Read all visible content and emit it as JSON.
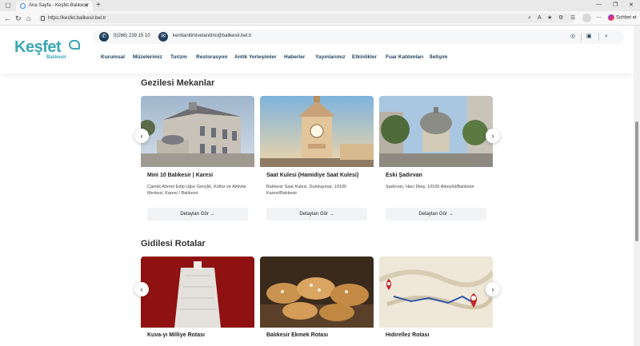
{
  "browser": {
    "tab_title": "Ana Sayfa - Keşfet Balıkesir",
    "url": "https://kesfet.balikesir.bel.tr",
    "copilot_label": "Sohbet et"
  },
  "header": {
    "logo_word": "Keşfet",
    "logo_sub": "Balıkesir",
    "phone": "0(266) 239 15 10",
    "email": "kenttanitimivetanitimi@balikesir.bel.tr",
    "menu": [
      "Kurumsal",
      "Müzelerimiz",
      "Turizm",
      "Restorasyon",
      "Antik Yerleşimler",
      "Haberler",
      "Yayınlarımız",
      "Etkinlikler",
      "Fuar Katılımları",
      "İletişim"
    ]
  },
  "places": {
    "title": "Gezilesi Mekanlar",
    "items": [
      {
        "name": "Mini 10 Balıkesir | Karesi",
        "address": "Çamlık Ahmet Edip Uğur Gençlik, Kültür ve Aktivite Merkezi, Karesi / Balıkesir",
        "button": "Detayları Gör"
      },
      {
        "name": "Saat Kulesi (Hamidiye Saat Kulesi)",
        "address": "Balıkesir Saat Kulesi, Dumlupınar, 10100 Karesi/Balıkesir",
        "button": "Detayları Gör"
      },
      {
        "name": "Eski Şadırvan",
        "address": "Şadırvan, Hacı İlbey, 10100 Altıeylül/Balıkesir",
        "button": "Detayları Gör"
      }
    ]
  },
  "routes": {
    "title": "Gidilesi Rotalar",
    "items": [
      {
        "name": "Kuva-yı Milliye Rotası"
      },
      {
        "name": "Balıkesir Ekmek Rotası"
      },
      {
        "name": "Hıdırellez Rotası"
      }
    ]
  },
  "colors": {
    "brand": "#3aa7b5",
    "navy": "#1f3d5c"
  }
}
